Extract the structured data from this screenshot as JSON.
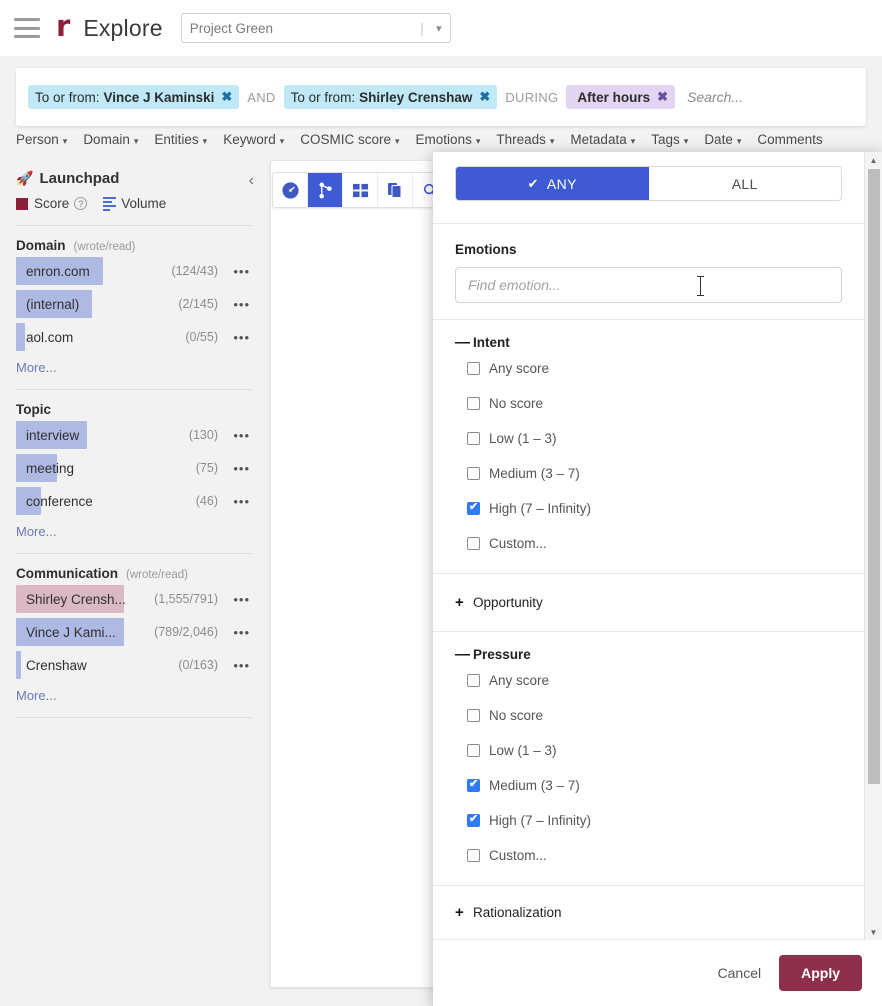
{
  "header": {
    "menu_icon": "hamburger-icon",
    "logo": "r",
    "title": "Explore",
    "project": {
      "value": "Project Green",
      "caret": "▾"
    }
  },
  "search": {
    "pills": [
      {
        "prefix": "To or from:",
        "value": "Vince J Kaminski",
        "kind": "person",
        "close": "✖"
      },
      {
        "prefix": "To or from:",
        "value": "Shirley Crenshaw",
        "kind": "person",
        "close": "✖"
      },
      {
        "prefix": "",
        "value": "After hours",
        "kind": "during",
        "close": "✖"
      }
    ],
    "conj_and": "AND",
    "conj_during": "DURING",
    "placeholder": "Search..."
  },
  "filterbar": {
    "items": [
      {
        "label": "Person",
        "caret": "▾"
      },
      {
        "label": "Domain",
        "caret": "▾"
      },
      {
        "label": "Entities",
        "caret": "▾"
      },
      {
        "label": "Keyword",
        "caret": "▾"
      },
      {
        "label": "COSMIC score",
        "caret": "▾"
      },
      {
        "label": "Emotions",
        "caret": "▾"
      },
      {
        "label": "Threads",
        "caret": "▾"
      },
      {
        "label": "Metadata",
        "caret": "▾"
      },
      {
        "label": "Tags",
        "caret": "▾"
      },
      {
        "label": "Date",
        "caret": "▾"
      },
      {
        "label": "Comments",
        "caret": "▾"
      }
    ]
  },
  "sidebar": {
    "title": "Launchpad",
    "rocket_icon": "rocket-icon",
    "collapse_icon": "‹",
    "mode_score": "Score",
    "mode_score_help": "?",
    "mode_volume": "Volume",
    "sections": [
      {
        "title": "Domain",
        "subtitle": "(wrote/read)",
        "more": "More...",
        "rows": [
          {
            "label": "enron.com",
            "count": "(124/43)",
            "bar_pct": 100,
            "bar": "blue",
            "dots": "•••"
          },
          {
            "label": "(internal)",
            "count": "(2/145)",
            "bar_pct": 79,
            "bar": "blue",
            "dots": "•••"
          },
          {
            "label": "aol.com",
            "count": "(0/55)",
            "bar_pct": 11,
            "bar": "blue",
            "dots": "•••"
          }
        ]
      },
      {
        "title": "Topic",
        "subtitle": "",
        "more": "More...",
        "rows": [
          {
            "label": "interview",
            "count": "(130)",
            "bar_pct": 100,
            "bar": "blue",
            "dots": "•••"
          },
          {
            "label": "meeting",
            "count": "(75)",
            "bar_pct": 58,
            "bar": "blue",
            "dots": "•••"
          },
          {
            "label": "conference",
            "count": "(46)",
            "bar_pct": 35,
            "bar": "blue",
            "dots": "•••"
          }
        ]
      },
      {
        "title": "Communication",
        "subtitle": "(wrote/read)",
        "more": "More...",
        "rows": [
          {
            "label": "Shirley Crensh...",
            "count": "(1,555/791)",
            "bar_pct": 100,
            "bar": "red",
            "dots": "•••"
          },
          {
            "label": "Vince J Kami...",
            "count": "(789/2,046)",
            "bar_pct": 100,
            "bar": "blue",
            "dots": "•••"
          },
          {
            "label": "Crenshaw",
            "count": "(0/163)",
            "bar_pct": 5,
            "bar": "blue",
            "dots": "•••"
          }
        ]
      }
    ]
  },
  "viewtoolbar": {
    "tools": [
      {
        "icon": "gauge-icon",
        "active": false
      },
      {
        "icon": "network-graph-icon",
        "active": true
      },
      {
        "icon": "grid-icon",
        "active": false
      },
      {
        "icon": "documents-icon",
        "active": false
      },
      {
        "icon": "magnifier-icon",
        "active": false
      }
    ]
  },
  "modal": {
    "toggle": {
      "any": "ANY",
      "all": "ALL",
      "check": "✔",
      "selected": "ANY"
    },
    "emotions_label": "Emotions",
    "emotions_placeholder": "Find emotion...",
    "groups": [
      {
        "name": "Intent",
        "expanded": true,
        "toggle": "➖",
        "options": [
          {
            "label": "Any score",
            "checked": false
          },
          {
            "label": "No score",
            "checked": false
          },
          {
            "label": "Low (1 – 3)",
            "checked": false
          },
          {
            "label": "Medium (3 – 7)",
            "checked": false
          },
          {
            "label": "High (7 – Infinity)",
            "checked": true
          },
          {
            "label": "Custom...",
            "checked": false
          }
        ]
      },
      {
        "name": "Opportunity",
        "expanded": false,
        "toggle": "➕",
        "options": []
      },
      {
        "name": "Pressure",
        "expanded": true,
        "toggle": "➖",
        "options": [
          {
            "label": "Any score",
            "checked": false
          },
          {
            "label": "No score",
            "checked": false
          },
          {
            "label": "Low (1 – 3)",
            "checked": false
          },
          {
            "label": "Medium (3 – 7)",
            "checked": true
          },
          {
            "label": "High (7 – Infinity)",
            "checked": true
          },
          {
            "label": "Custom...",
            "checked": false
          }
        ]
      },
      {
        "name": "Rationalization",
        "expanded": false,
        "toggle": "➕",
        "options": []
      }
    ],
    "scroll_up": "▲",
    "scroll_down": "▼",
    "cancel": "Cancel",
    "apply": "Apply"
  },
  "colors": {
    "brand": "#8e1f38",
    "accent_blue": "#3f5bd4",
    "pill_person": "#bfe9f7",
    "pill_during": "#e2d4f2",
    "bar_blue": "#aebae4",
    "bar_red": "#dbb9c2",
    "apply_button": "#8e2f4c",
    "checkbox_on": "#2f7af5"
  }
}
